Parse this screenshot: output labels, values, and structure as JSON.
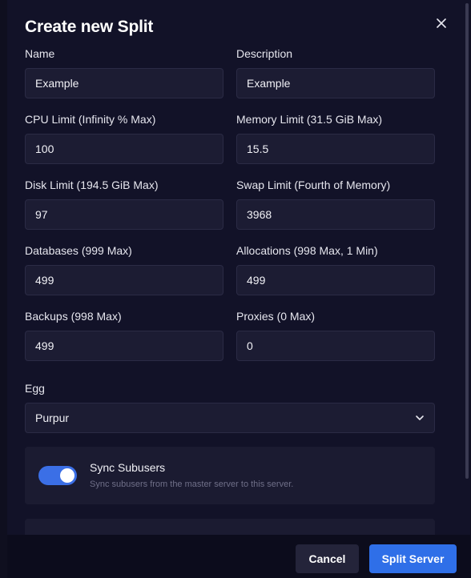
{
  "dialog": {
    "title": "Create new Split",
    "close_label": "×"
  },
  "fields": [
    {
      "label": "Name",
      "value": "Example"
    },
    {
      "label": "Description",
      "value": "Example"
    },
    {
      "label": "CPU Limit (Infinity % Max)",
      "value": "100"
    },
    {
      "label": "Memory Limit (31.5 GiB Max)",
      "value": "15.5"
    },
    {
      "label": "Disk Limit (194.5 GiB Max)",
      "value": "97"
    },
    {
      "label": "Swap Limit (Fourth of Memory)",
      "value": "3968"
    },
    {
      "label": "Databases (999 Max)",
      "value": "499"
    },
    {
      "label": "Allocations (998 Max, 1 Min)",
      "value": "499"
    },
    {
      "label": "Backups (998 Max)",
      "value": "499"
    },
    {
      "label": "Proxies (0 Max)",
      "value": "0"
    }
  ],
  "egg": {
    "label": "Egg",
    "selected": "Purpur"
  },
  "sync_subusers": {
    "title": "Sync Subusers",
    "description": "Sync subusers from the master server to this server.",
    "enabled": true
  },
  "footer": {
    "cancel_label": "Cancel",
    "submit_label": "Split Server"
  },
  "colors": {
    "accent": "#2f6fe8",
    "background": "#121228",
    "input_bg": "#1c1c33"
  }
}
